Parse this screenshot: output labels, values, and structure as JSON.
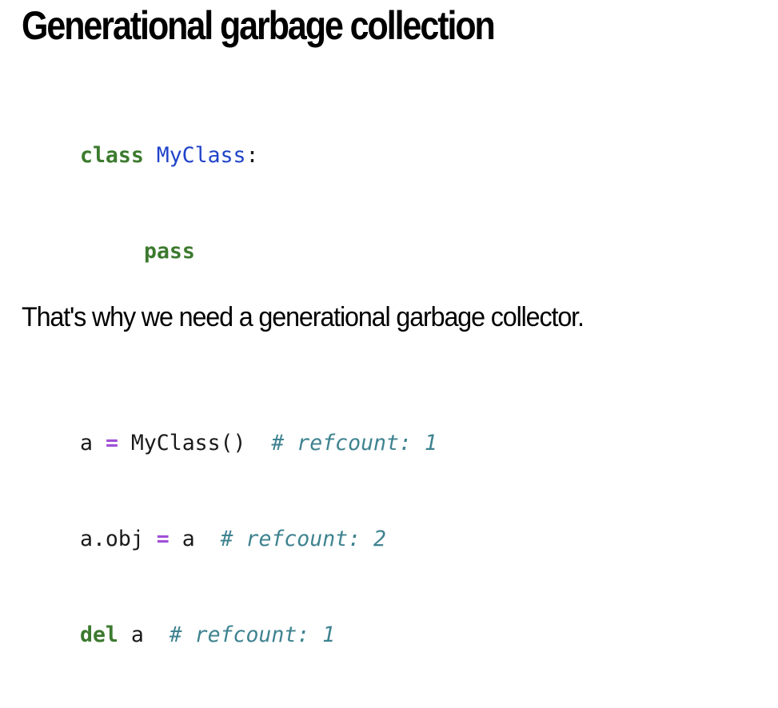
{
  "slide": {
    "title": "Generational garbage collection",
    "code": {
      "line1": {
        "kw": "class",
        "sp": " ",
        "cls": "MyClass",
        "colon": ":"
      },
      "line2": {
        "kw": "pass"
      },
      "line4": {
        "a": "a",
        "sp1": " ",
        "op": "=",
        "sp2": " ",
        "call": "MyClass()",
        "sp3": "  ",
        "comment": "# refcount: 1"
      },
      "line5": {
        "lhs": "a.obj",
        "sp1": " ",
        "op": "=",
        "sp2": " ",
        "rhs": "a",
        "sp3": "  ",
        "comment": "# refcount: 2"
      },
      "line6": {
        "kw": "del",
        "sp1": " ",
        "var": "a",
        "sp2": "  ",
        "comment": "# refcount: 1"
      }
    },
    "caption": "That's why we need a generational garbage collector."
  },
  "colors": {
    "keyword": "#3c7a2e",
    "class_name": "#1f43c9",
    "operator": "#a150d6",
    "comment": "#3f8390",
    "text": "#1a1a1a"
  }
}
